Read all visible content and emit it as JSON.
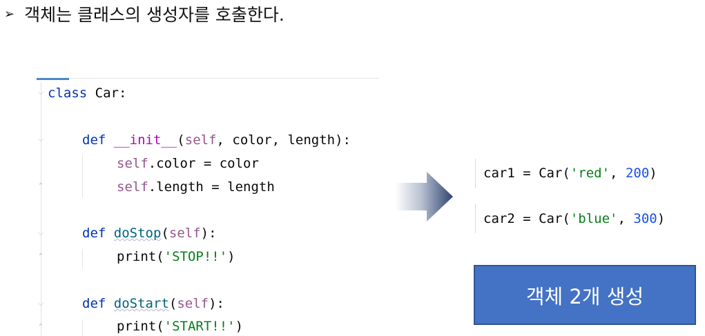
{
  "heading": {
    "bullet": "➢",
    "text": "객체는 클래스의 생성자를 호출한다."
  },
  "code": {
    "line1": {
      "kw": "class",
      "rest": " Car:"
    },
    "line2": {
      "kw": "def",
      "name": "__init__",
      "open": "(",
      "self": "self",
      "rest": ", color, length):"
    },
    "line3": {
      "self": "self",
      "rest": ".color = color"
    },
    "line4": {
      "self": "self",
      "rest": ".length = length"
    },
    "line5": {
      "kw": "def",
      "name": "doStop",
      "open": "(",
      "self": "self",
      "close": "):"
    },
    "line6": {
      "fn": "print",
      "open": "(",
      "str": "'STOP!!'",
      "close": ")"
    },
    "line7": {
      "kw": "def",
      "name": "doStart",
      "open": "(",
      "self": "self",
      "close": "):"
    },
    "line8": {
      "fn": "print",
      "open": "(",
      "str": "'START!!'",
      "close": ")"
    }
  },
  "snippets": [
    {
      "lhs": "car1 = Car(",
      "str": "'red'",
      "sep": ", ",
      "num": "200",
      "close": ")"
    },
    {
      "lhs": "car2 = Car(",
      "str": "'blue'",
      "sep": ", ",
      "num": "300",
      "close": ")"
    }
  ],
  "result": {
    "label": "객체 2개 생성"
  },
  "colors": {
    "accent": "#4472c4",
    "keyword": "#0033b3",
    "string": "#067d17",
    "number": "#1750eb",
    "self": "#94558d"
  },
  "icons": {
    "arrow": "gradient-right-arrow-icon",
    "fold": "fold-marker-icon"
  }
}
